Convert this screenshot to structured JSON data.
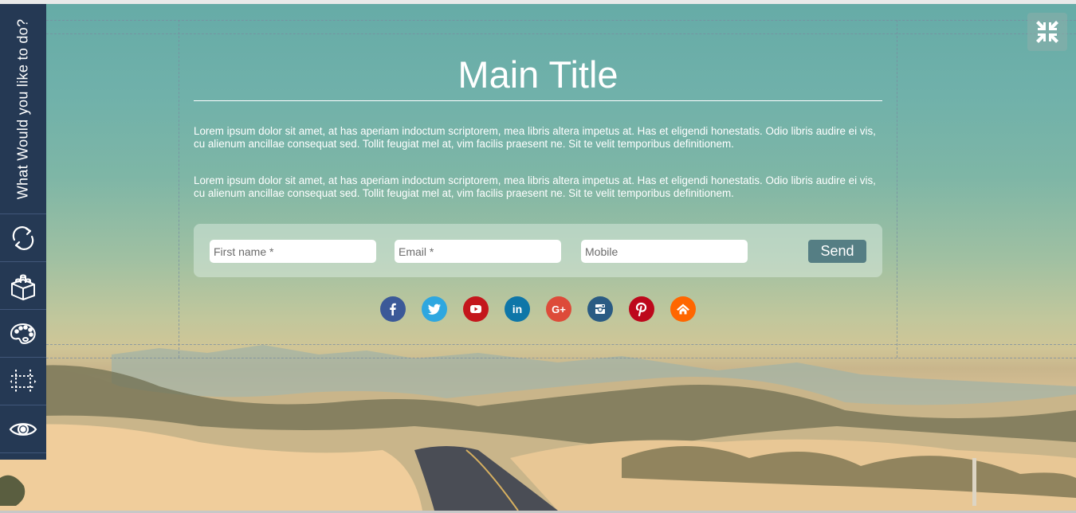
{
  "sidebar": {
    "title": "What Would you like to do?",
    "items": [
      {
        "name": "refresh",
        "icon": "refresh-icon"
      },
      {
        "name": "blocks",
        "icon": "lego-block-icon"
      },
      {
        "name": "palette",
        "icon": "palette-icon"
      },
      {
        "name": "spacing",
        "icon": "spacing-guides-icon"
      },
      {
        "name": "preview",
        "icon": "eye-icon"
      }
    ]
  },
  "toolbar": {
    "collapse_icon": "compress-arrows-icon"
  },
  "main": {
    "title": "Main Title",
    "paragraphs": [
      "Lorem ipsum dolor sit amet, at has aperiam indoctum scriptorem, mea libris altera impetus at. Has et eligendi honestatis. Odio libris audire ei vis, cu alienum ancillae consequat sed. Tollit feugiat mel at, vim facilis praesent ne. Sit te velit temporibus definitionem.",
      "Lorem ipsum dolor sit amet, at has aperiam indoctum scriptorem, mea libris altera impetus at. Has et eligendi honestatis. Odio libris audire ei vis, cu alienum ancillae consequat sed. Tollit feugiat mel at, vim facilis praesent ne. Sit te velit temporibus definitionem."
    ]
  },
  "form": {
    "first_name": {
      "value": "",
      "placeholder": "First name *"
    },
    "email": {
      "value": "",
      "placeholder": "Email *"
    },
    "mobile": {
      "value": "",
      "placeholder": "Mobile"
    },
    "send_label": "Send",
    "send_color": "#557e84"
  },
  "social": [
    {
      "name": "facebook",
      "icon": "facebook-icon",
      "color": "#3b5998"
    },
    {
      "name": "twitter",
      "icon": "twitter-icon",
      "color": "#2ea7e0"
    },
    {
      "name": "youtube",
      "icon": "youtube-icon",
      "color": "#c4161c"
    },
    {
      "name": "linkedin",
      "icon": "linkedin-icon",
      "color": "#0e76a8"
    },
    {
      "name": "google-plus",
      "icon": "google-plus-icon",
      "color": "#dd4b39"
    },
    {
      "name": "instagram",
      "icon": "instagram-icon",
      "color": "#2a5b83"
    },
    {
      "name": "pinterest",
      "icon": "pinterest-icon",
      "color": "#bd081c"
    },
    {
      "name": "home",
      "icon": "home-icon",
      "color": "#ff6600"
    }
  ],
  "colors": {
    "sidebar_bg": "#253954",
    "accent": "#557e84"
  }
}
